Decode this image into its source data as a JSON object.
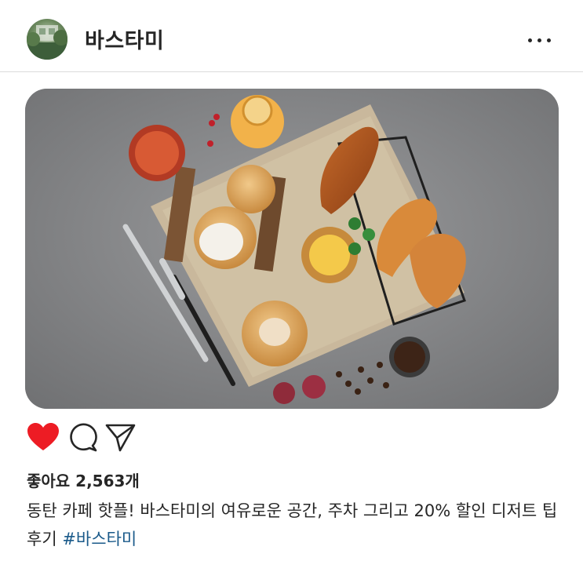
{
  "post": {
    "username": "바스타미",
    "likes_text": "좋아요 2,563개",
    "caption": "동탄 카페 핫플! 바스타미의 여유로운 공간, 주차 그리고  20% 할인 디저트 팁 후기 ",
    "hashtag": "#바스타미"
  },
  "icons": {
    "more": "more-horizontal-icon",
    "like": "heart-icon",
    "comment": "comment-icon",
    "share": "send-icon"
  },
  "colors": {
    "like_active": "#ed1c24",
    "hashtag": "#1a5a8a",
    "text": "#262626"
  }
}
